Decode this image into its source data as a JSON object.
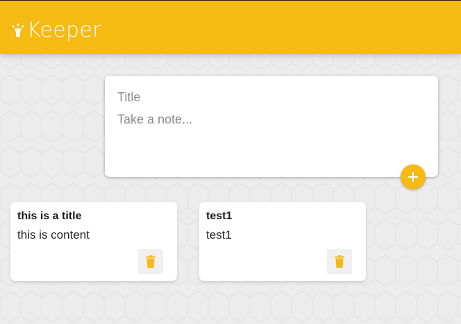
{
  "header": {
    "app_title": "Keeper",
    "brand_color": "#f5ba13",
    "logo_icon": "lightbulb-icon"
  },
  "create_note": {
    "title_placeholder": "Title",
    "content_placeholder": "Take a note...",
    "add_icon": "plus-icon"
  },
  "notes": [
    {
      "title": "this is a title",
      "content": "this is content",
      "delete_icon": "trash-icon"
    },
    {
      "title": "test1",
      "content": "test1",
      "delete_icon": "trash-icon"
    }
  ]
}
